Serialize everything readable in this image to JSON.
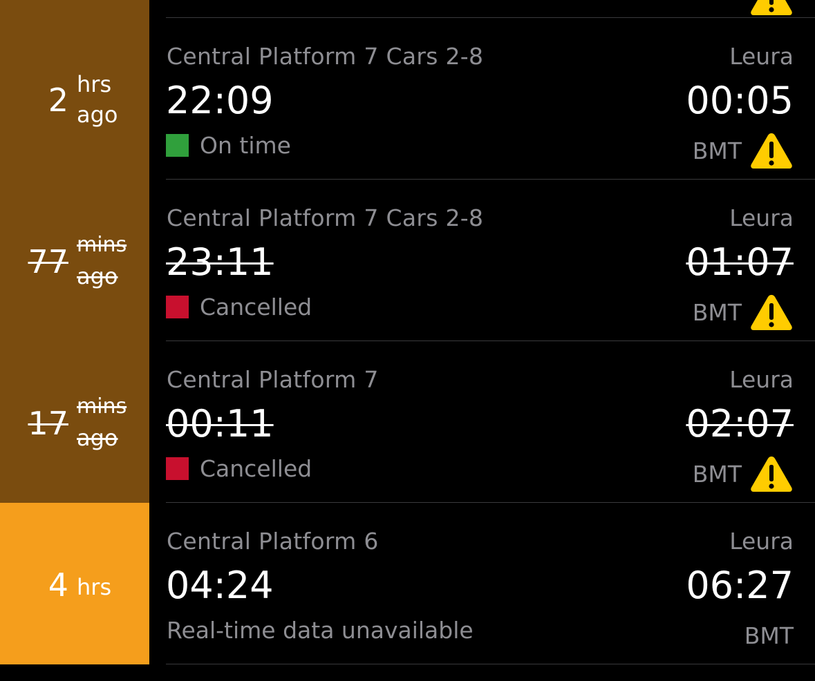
{
  "colors": {
    "past_side": "#7a4c0f",
    "upcoming_side": "#f59e1c",
    "on_time": "#30a03c",
    "cancelled": "#c8102e",
    "muted_text": "#8e8e93",
    "warning": "#ffcc00"
  },
  "trips": [
    {
      "ago_number": "2",
      "ago_unit_line1": "hrs",
      "ago_unit_line2": "ago",
      "origin": "Central Platform 7 Cars 2-8",
      "destination": "Leura",
      "departure": "22:09",
      "arrival": "00:05",
      "status": "On time",
      "line": "BMT",
      "alert_icon": "warning-triangle"
    },
    {
      "ago_number": "77",
      "ago_unit_line1": "mins",
      "ago_unit_line2": "ago",
      "origin": "Central Platform 7 Cars 2-8",
      "destination": "Leura",
      "departure": "23:11",
      "arrival": "01:07",
      "status": "Cancelled",
      "line": "BMT",
      "alert_icon": "warning-triangle"
    },
    {
      "ago_number": "17",
      "ago_unit_line1": "mins",
      "ago_unit_line2": "ago",
      "origin": "Central Platform 7",
      "destination": "Leura",
      "departure": "00:11",
      "arrival": "02:07",
      "status": "Cancelled",
      "line": "BMT",
      "alert_icon": "warning-triangle"
    },
    {
      "ago_number": "4",
      "ago_unit_line1": "hrs",
      "origin": "Central Platform 6",
      "destination": "Leura",
      "departure": "04:24",
      "arrival": "06:27",
      "status": "Real-time data unavailable",
      "line": "BMT"
    }
  ]
}
